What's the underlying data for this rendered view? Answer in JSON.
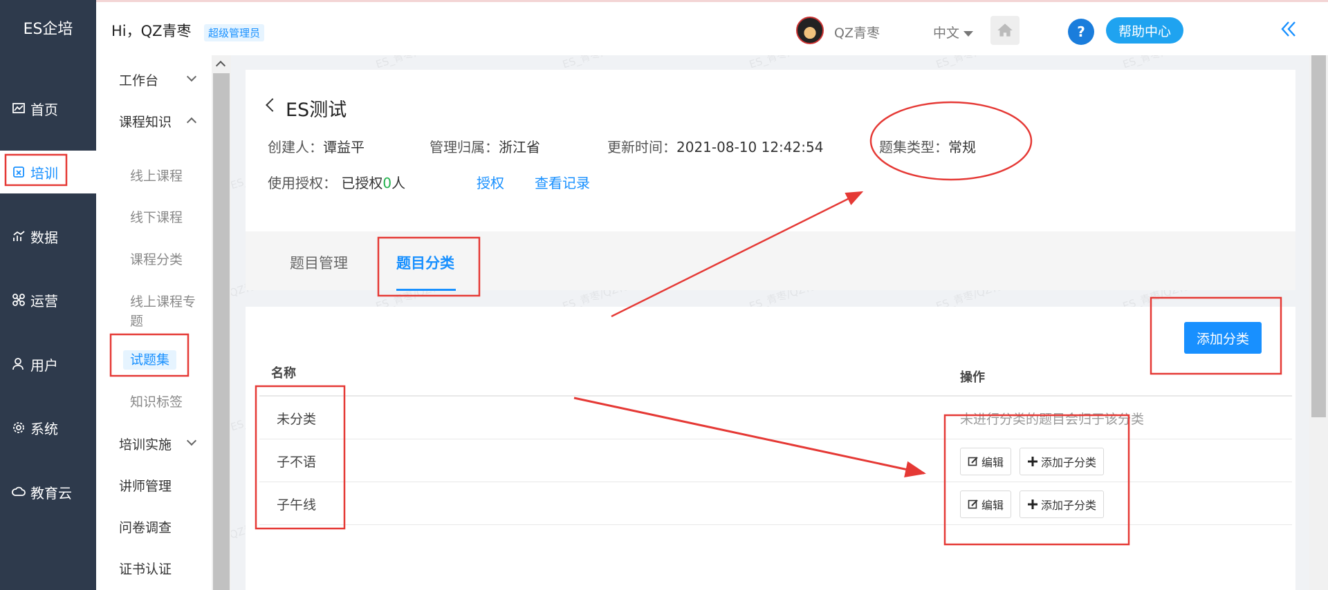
{
  "brand": "ES企培",
  "rail": [
    {
      "label": "首页",
      "icon": "chart-icon"
    },
    {
      "label": "培训",
      "icon": "training-icon",
      "active": true
    },
    {
      "label": "数据",
      "icon": "data-icon"
    },
    {
      "label": "运营",
      "icon": "operation-icon"
    },
    {
      "label": "用户",
      "icon": "user-icon"
    },
    {
      "label": "系统",
      "icon": "gear-icon"
    },
    {
      "label": "教育云",
      "icon": "cloud-icon"
    }
  ],
  "header": {
    "greeting": "Hi，QZ青枣",
    "role": "超级管理员",
    "user_name": "QZ青枣",
    "language": "中文",
    "help": "帮助中心",
    "help_q": "?"
  },
  "submenu": {
    "group1": "工作台",
    "group2": "课程知识",
    "items": [
      "线上课程",
      "线下课程",
      "课程分类",
      "线上课程专题",
      "试题集",
      "知识标签"
    ],
    "group3": "培训实施",
    "group4": "讲师管理",
    "group5": "问卷调查",
    "group6": "证书认证"
  },
  "detail": {
    "title": "ES测试",
    "creator_label": "创建人：",
    "creator": "谭益平",
    "owner_label": "管理归属：",
    "owner": "浙江省",
    "updated_label": "更新时间：",
    "updated": "2021-08-10 12:42:54",
    "type_label": "题集类型：",
    "type": "常规",
    "auth_label": "使用授权：",
    "auth_prefix": "已授权",
    "auth_count": "0",
    "auth_suffix": "人",
    "auth_link": "授权",
    "record_link": "查看记录"
  },
  "tabs": [
    "题目管理",
    "题目分类"
  ],
  "table": {
    "add_button": "添加分类",
    "col_name": "名称",
    "col_ops": "操作",
    "rows": [
      {
        "name": "未分类",
        "desc": "未进行分类的题目会归于该分类"
      },
      {
        "name": "子不语",
        "edit": "编辑",
        "add_sub": "添加子分类"
      },
      {
        "name": "子午线",
        "edit": "编辑",
        "add_sub": "添加子分类"
      }
    ]
  },
  "watermark": "ES_青枣/QZ青枣/测试",
  "colors": {
    "accent": "#1890ff",
    "rail": "#2e3a4c",
    "annotation": "#e53935"
  }
}
